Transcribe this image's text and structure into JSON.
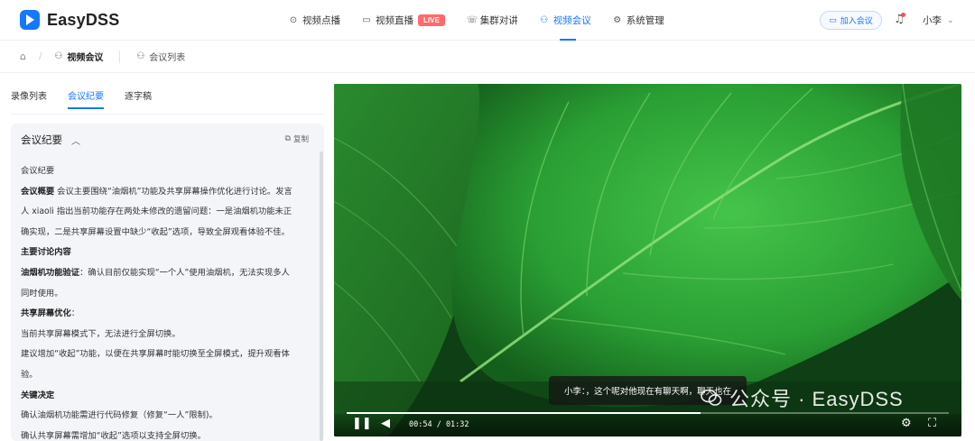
{
  "app": {
    "name": "EasyDSS"
  },
  "nav": {
    "items": [
      {
        "label": "视频点播",
        "icon": "play-circle-icon"
      },
      {
        "label": "视频直播",
        "icon": "video-camera-icon",
        "badge": "LIVE"
      },
      {
        "label": "集群对讲",
        "icon": "phone-icon"
      },
      {
        "label": "视频会议",
        "icon": "meeting-users-icon",
        "active": true
      },
      {
        "label": "系统管理",
        "icon": "gear-icon"
      }
    ],
    "join_meeting": "加入会议",
    "user_name": "小李"
  },
  "breadcrumb": {
    "items": [
      "视频会议",
      "会议列表"
    ]
  },
  "left_panel": {
    "tabs": [
      {
        "label": "录像列表"
      },
      {
        "label": "会议纪要",
        "active": true
      },
      {
        "label": "逐字稿"
      }
    ],
    "card": {
      "title": "会议纪要",
      "copy_label": "复制",
      "lines": [
        {
          "text": "会议纪要"
        },
        {
          "bold": "会议概要",
          "text": " 会议主要围绕“油烟机”功能及共享屏幕操作优化进行讨论。发言"
        },
        {
          "text": "人 xiaoli 指出当前功能存在两处未修改的遗留问题：一是油烟机功能未正"
        },
        {
          "text": "确实现，二是共享屏幕设置中缺少“收起”选项，导致全屏观看体验不佳。"
        },
        {
          "bold": "主要讨论内容",
          "text": ""
        },
        {
          "bold": "油烟机功能验证",
          "text": "：确认目前仅能实现“一个人”使用油烟机，无法实现多人"
        },
        {
          "text": "同时使用。"
        },
        {
          "bold": "共享屏幕优化",
          "text": "："
        },
        {
          "text": "当前共享屏幕模式下，无法进行全屏切换。"
        },
        {
          "text": "建议增加“收起”功能，以便在共享屏幕时能切换至全屏模式，提升观看体"
        },
        {
          "text": "验。"
        },
        {
          "bold": "关键决定",
          "text": ""
        },
        {
          "text": "确认油烟机功能需进行代码修复（修复“一人”限制)。"
        },
        {
          "text": "确认共享屏幕需增加“收起”选项以支持全屏切换。"
        }
      ]
    }
  },
  "player": {
    "subtitle": "小李：，这个呢对他现在有聊天啊，聊天也在",
    "time": "00:54 / 01:32",
    "progress": 0.587,
    "watermark": "公众号 · EasyDSS",
    "colors": {
      "leaf": "#2fa83a",
      "leaf_dark": "#0d4414",
      "vein": "#7fd46a"
    }
  }
}
